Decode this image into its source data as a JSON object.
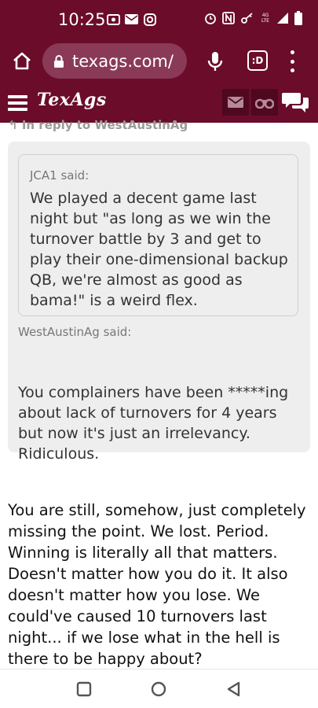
{
  "status": {
    "time": "10:25",
    "network_label": "4G LTE",
    "icons": [
      "screen-icon",
      "mail-icon",
      "instagram-icon",
      "alarm-icon",
      "nfc-icon",
      "key-icon",
      "signal-icon",
      "battery-icon"
    ]
  },
  "browser": {
    "url": "texags.com/",
    "tabs_label": ":D"
  },
  "site": {
    "logo": "TexAgs"
  },
  "post": {
    "reply_to": "In reply to WestAustinAg",
    "quote1_author": "JCA1 said:",
    "quote1_text": "We played a decent game last night but \"as long as we win the turnover battle by 3 and get to play their one-dimensional backup QB, we're almost as good as bama!\" is a weird flex.",
    "quote2_author": "WestAustinAg said:",
    "quote2_text": "You complainers have been *****ing about lack of turnovers for 4 years but now it's just an irrelevancy. Ridiculous.",
    "body": "You are still, somehow, just completely missing the point. We lost. Period. Winning is literally all that matters. Doesn't matter how you do it. It also doesn't matter how you lose. We could've caused 10 turnovers last night... if we lose what in the hell is there to be happy about?"
  },
  "colors": {
    "brand": "#6b0c2b",
    "url_pill": "#8a3a57",
    "quote_bg": "#eeeeee"
  }
}
